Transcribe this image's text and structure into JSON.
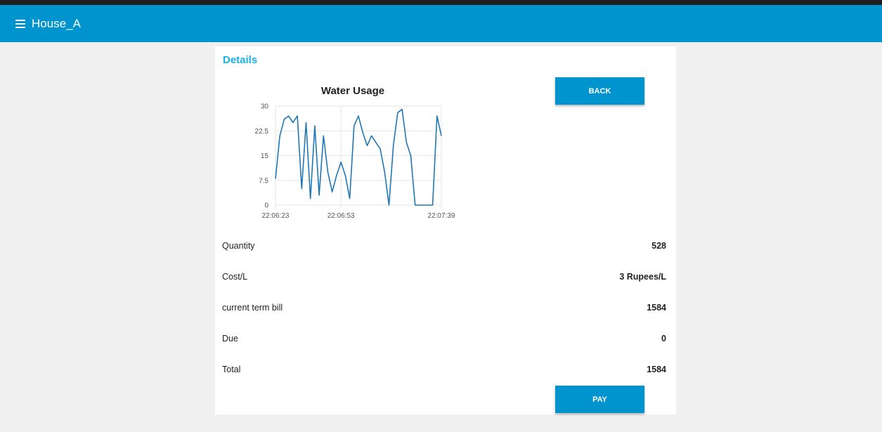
{
  "header": {
    "title": "House_A",
    "menu_icon": "hamburger-menu-icon",
    "bar_color": "#0094ce"
  },
  "card": {
    "title": "Details",
    "buttons": {
      "back": "BACK",
      "pay": "PAY"
    },
    "rows": [
      {
        "label": "Quantity",
        "value": "528"
      },
      {
        "label": "Cost/L",
        "value": "3 Rupees/L"
      },
      {
        "label": "current term bill",
        "value": "1584"
      },
      {
        "label": "Due",
        "value": "0"
      },
      {
        "label": "Total",
        "value": "1584"
      }
    ]
  },
  "chart_data": {
    "type": "line",
    "title": "Water Usage",
    "xlabel": "",
    "ylabel": "",
    "ylim": [
      0,
      30
    ],
    "yticks": [
      "0",
      "7.5",
      "15",
      "22.5",
      "30"
    ],
    "xticks": [
      "22:06:23",
      "22:06:53",
      "22:07:39"
    ],
    "x_start": "22:06:23",
    "x_end": "22:07:39",
    "grid": true,
    "line_color": "#1f77b4",
    "series": [
      {
        "values": [
          8,
          21,
          26,
          27,
          25,
          27,
          5,
          25,
          2,
          24,
          3,
          21,
          10,
          4,
          9,
          13,
          9,
          2,
          24,
          27,
          22,
          18,
          21,
          19,
          17,
          10,
          0,
          18,
          28,
          29,
          19,
          15,
          0,
          0,
          0,
          0,
          0,
          27,
          21
        ]
      }
    ]
  }
}
